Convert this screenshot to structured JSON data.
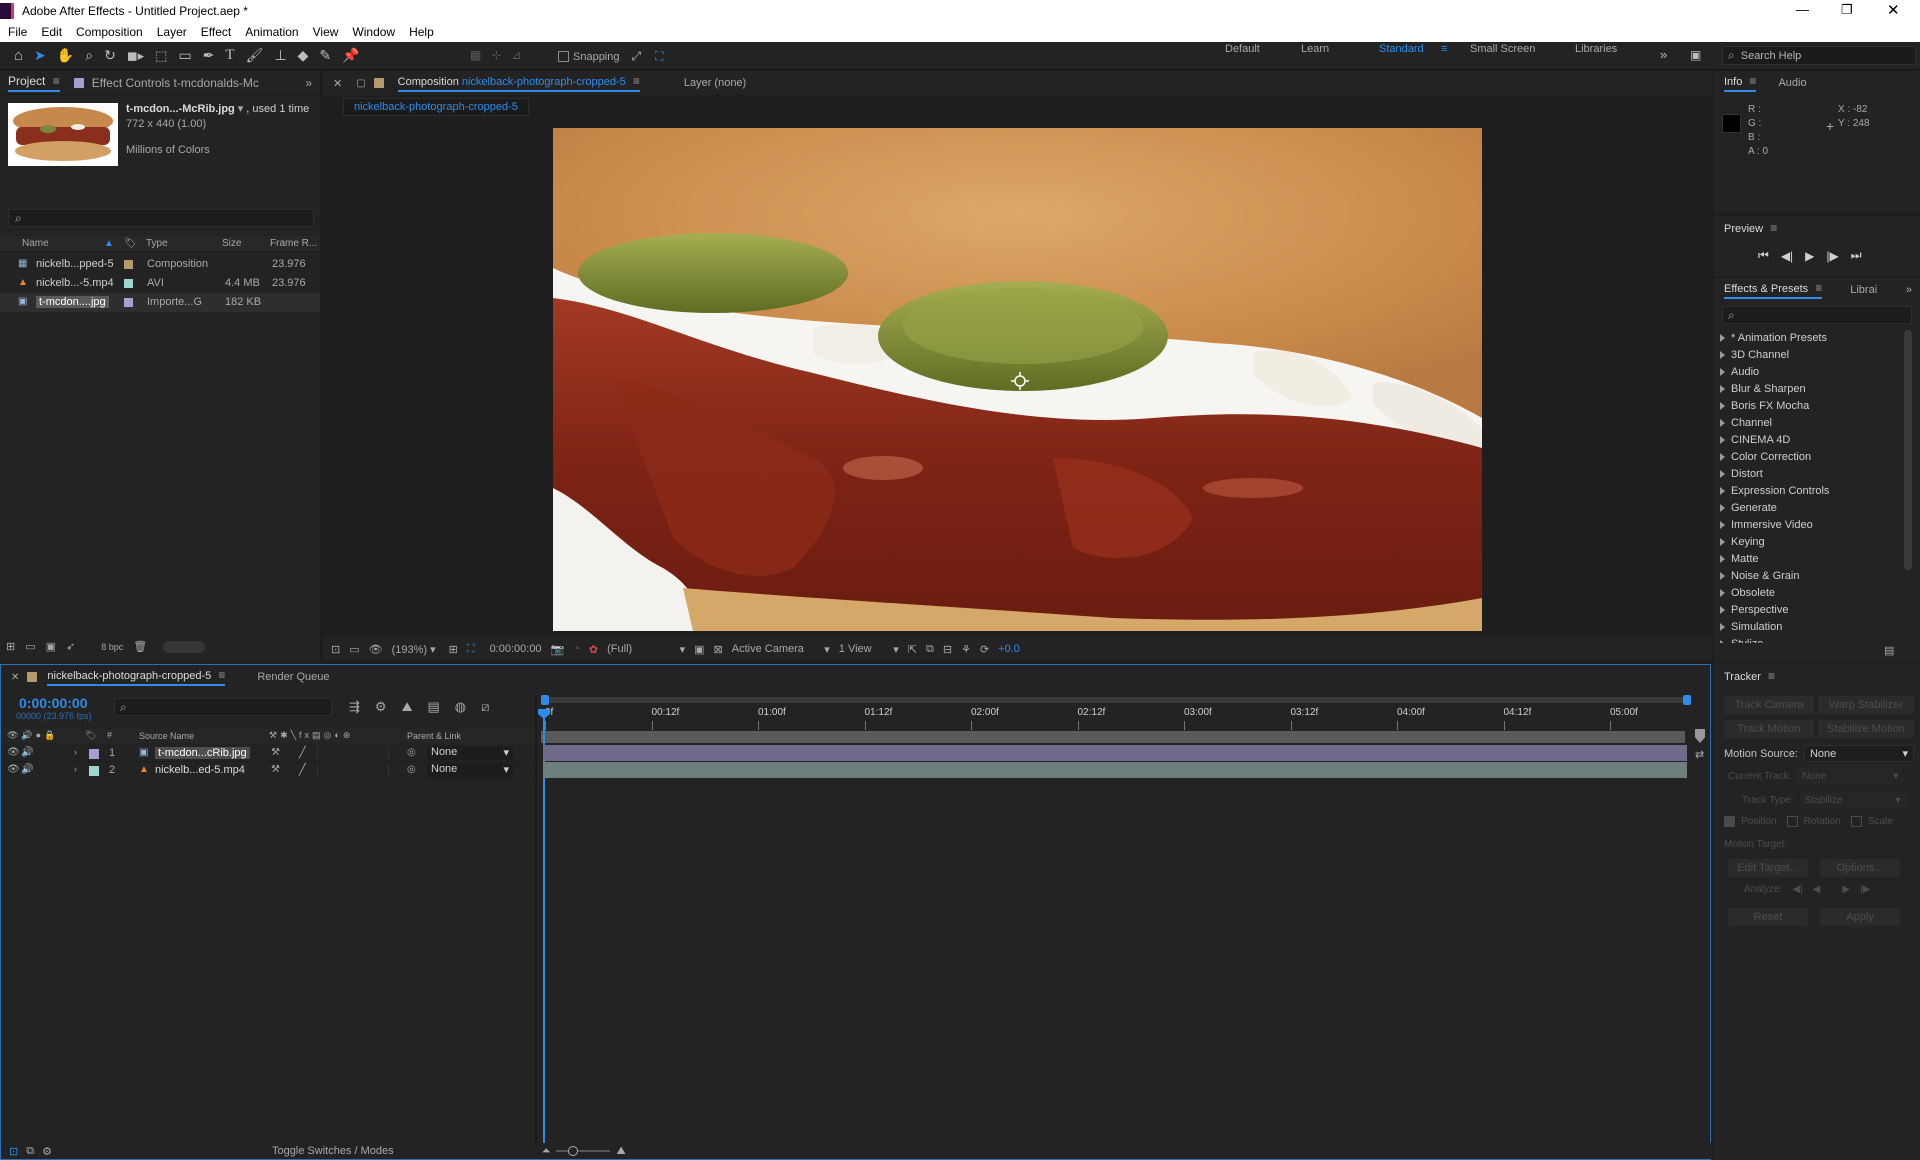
{
  "window": {
    "title": "Adobe After Effects - Untitled Project.aep *",
    "controls": [
      "—",
      "❐",
      "✕"
    ]
  },
  "menu": [
    "File",
    "Edit",
    "Composition",
    "Layer",
    "Effect",
    "Animation",
    "View",
    "Window",
    "Help"
  ],
  "toolbar": {
    "snapping_label": "Snapping",
    "workspaces": [
      "Default",
      "Learn",
      "Standard",
      "Small Screen",
      "Libraries"
    ],
    "active_workspace": "Standard",
    "search_placeholder": "Search Help"
  },
  "project_panel": {
    "tab_project": "Project",
    "tab_effect_controls": "Effect Controls t-mcdonalds-Mc",
    "asset": {
      "name": "t-mcdon...-McRib.jpg",
      "usage": ", used 1 time",
      "dimensions": "772 x 440 (1.00)",
      "color": "Millions of Colors"
    },
    "columns": [
      "Name",
      "Type",
      "Size",
      "Frame R..."
    ],
    "items": [
      {
        "name": "nickelb...pped-5",
        "type": "Composition",
        "size": "",
        "fps": "23.976",
        "icon": "composition-icon",
        "color": "#b59a6c"
      },
      {
        "name": "nickelb...-5.mp4",
        "type": "AVI",
        "size": "4.4 MB",
        "fps": "23.976",
        "icon": "vlc-cone-icon",
        "color": "#9ed5d0"
      },
      {
        "name": "t-mcdon....jpg",
        "type": "Importe...G",
        "size": "182 KB",
        "fps": "",
        "icon": "image-file-icon",
        "color": "#a99dd1"
      }
    ],
    "footer_bpc": "8 bpc"
  },
  "composition_panel": {
    "tab_prefix": "Composition",
    "tab_name": "nickelback-photograph-cropped-5",
    "layer_tab": "Layer (none)",
    "breadcrumb": "nickelback-photograph-cropped-5",
    "zoom": "(193%)",
    "timecode": "0:00:00:00",
    "resolution": "(Full)",
    "camera": "Active Camera",
    "views": "1 View",
    "exposure": "+0.0"
  },
  "info_panel": {
    "tab_info": "Info",
    "tab_audio": "Audio",
    "r": "R :",
    "g": "G :",
    "b": "B :",
    "a": "A : 0",
    "x": "X : -82",
    "y": "Y : 248"
  },
  "preview_panel": {
    "title": "Preview"
  },
  "effects_panel": {
    "tab": "Effects & Presets",
    "tab2": "Librai",
    "categories": [
      "* Animation Presets",
      "3D Channel",
      "Audio",
      "Blur & Sharpen",
      "Boris FX Mocha",
      "Channel",
      "CINEMA 4D",
      "Color Correction",
      "Distort",
      "Expression Controls",
      "Generate",
      "Immersive Video",
      "Keying",
      "Matte",
      "Noise & Grain",
      "Obsolete",
      "Perspective",
      "Simulation",
      "Stylize"
    ]
  },
  "timeline": {
    "tab": "nickelback-photograph-cropped-5",
    "render_queue": "Render Queue",
    "timecode": "0:00:00:00",
    "fps_sub": "00000 (23.976 fps)",
    "col_source": "Source Name",
    "col_parent": "Parent & Link",
    "ruler": [
      "0f",
      "00:12f",
      "01:00f",
      "01:12f",
      "02:00f",
      "02:12f",
      "03:00f",
      "03:12f",
      "04:00f",
      "04:12f",
      "05:00f"
    ],
    "layers": [
      {
        "num": "1",
        "name": "t-mcdon...cRib.jpg",
        "parent": "None",
        "color": "#a99dd1",
        "icon": "image-file-icon",
        "bar": "#6e6a8a"
      },
      {
        "num": "2",
        "name": "nickelb...ed-5.mp4",
        "parent": "None",
        "color": "#9ed5d0",
        "icon": "vlc-cone-icon",
        "bar": "#6c7f7c"
      }
    ],
    "footer_toggle": "Toggle Switches / Modes"
  },
  "tracker_panel": {
    "title": "Tracker",
    "track_camera": "Track Camera",
    "warp_stabilizer": "Warp Stabilizer",
    "track_motion": "Track Motion",
    "stabilize_motion": "Stabilize Motion",
    "motion_source_label": "Motion Source:",
    "motion_source_value": "None",
    "current_track_label": "Current Track:",
    "current_track_value": "None",
    "track_type_label": "Track Type:",
    "track_type_value": "Stabilize",
    "position": "Position",
    "rotation": "Rotation",
    "scale": "Scale",
    "motion_target": "Motion Target:",
    "edit_target": "Edit Target...",
    "options": "Options...",
    "analyze": "Analyze:",
    "reset": "Reset",
    "apply": "Apply"
  }
}
